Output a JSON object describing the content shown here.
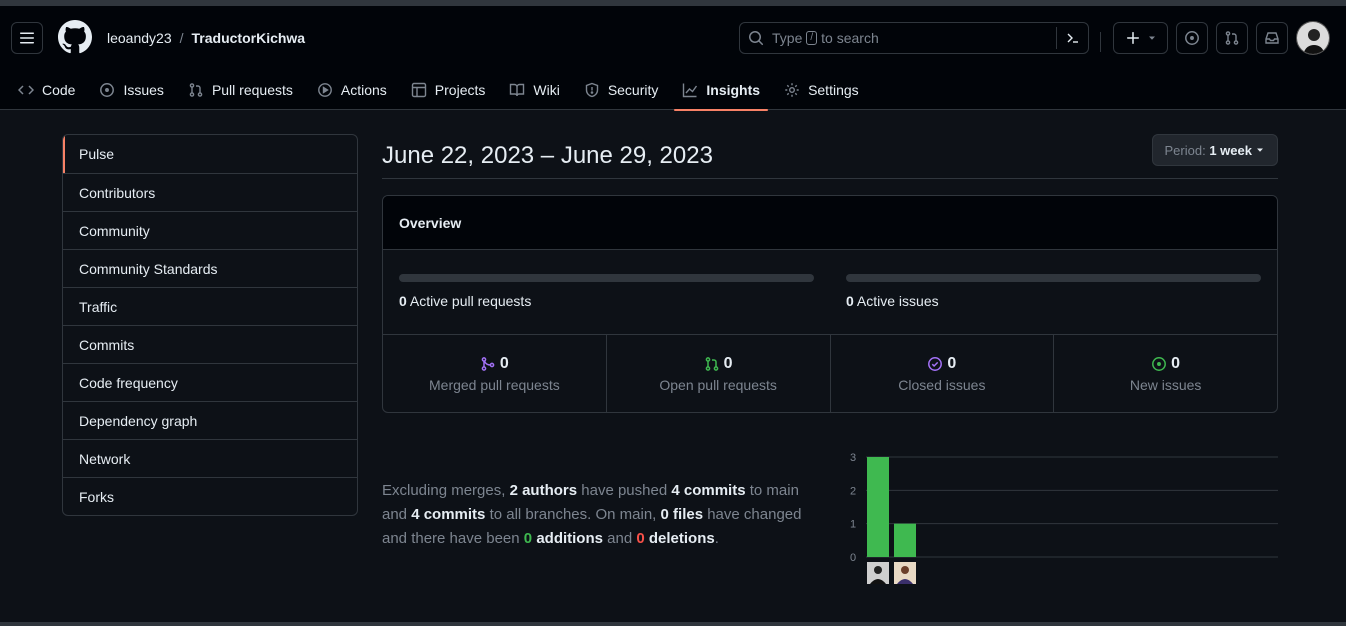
{
  "header": {
    "owner": "leoandy23",
    "separator": "/",
    "repo": "TraductorKichwa",
    "search": {
      "prefix": "Type",
      "key": "/",
      "suffix": "to search"
    }
  },
  "tabs": [
    {
      "label": "Code",
      "icon": "code-icon"
    },
    {
      "label": "Issues",
      "icon": "issue-opened-icon"
    },
    {
      "label": "Pull requests",
      "icon": "git-pull-request-icon"
    },
    {
      "label": "Actions",
      "icon": "play-icon"
    },
    {
      "label": "Projects",
      "icon": "table-icon"
    },
    {
      "label": "Wiki",
      "icon": "book-icon"
    },
    {
      "label": "Security",
      "icon": "shield-icon"
    },
    {
      "label": "Insights",
      "icon": "graph-icon",
      "active": true
    },
    {
      "label": "Settings",
      "icon": "gear-icon"
    }
  ],
  "sidebar": {
    "items": [
      {
        "label": "Pulse",
        "active": true
      },
      {
        "label": "Contributors"
      },
      {
        "label": "Community"
      },
      {
        "label": "Community Standards"
      },
      {
        "label": "Traffic"
      },
      {
        "label": "Commits"
      },
      {
        "label": "Code frequency"
      },
      {
        "label": "Dependency graph"
      },
      {
        "label": "Network"
      },
      {
        "label": "Forks"
      }
    ]
  },
  "main": {
    "date_range": "June 22, 2023 – June 29, 2023",
    "period_label": "Period:",
    "period_value": "1 week",
    "overview": {
      "title": "Overview",
      "active_prs_count": "0",
      "active_prs_label": "Active pull requests",
      "active_issues_count": "0",
      "active_issues_label": "Active issues",
      "stats": [
        {
          "count": "0",
          "label": "Merged pull requests",
          "icon": "git-merge-icon",
          "color": "#a371f7"
        },
        {
          "count": "0",
          "label": "Open pull requests",
          "icon": "git-pull-request-icon",
          "color": "#3fb950"
        },
        {
          "count": "0",
          "label": "Closed issues",
          "icon": "issue-closed-icon",
          "color": "#a371f7"
        },
        {
          "count": "0",
          "label": "New issues",
          "icon": "issue-opened-icon",
          "color": "#3fb950"
        }
      ]
    },
    "summary": {
      "p1": "Excluding merges,",
      "authors": "2 authors",
      "p2": "have pushed",
      "commits_main": "4 commits",
      "p3": "to main and",
      "commits_all": "4 commits",
      "p4": "to all branches. On main,",
      "files": "0 files",
      "p5": "have changed and there have been",
      "additions_num": "0",
      "additions_word": "additions",
      "p6": "and",
      "deletions_num": "0",
      "deletions_word": "deletions",
      "p7": "."
    }
  },
  "chart_data": {
    "type": "bar",
    "categories": [
      "author-1",
      "author-2"
    ],
    "values": [
      3,
      1
    ],
    "yticks": [
      0,
      1,
      2,
      3
    ],
    "ylim": [
      0,
      3
    ],
    "bar_color": "#3fb950",
    "grid": true
  }
}
